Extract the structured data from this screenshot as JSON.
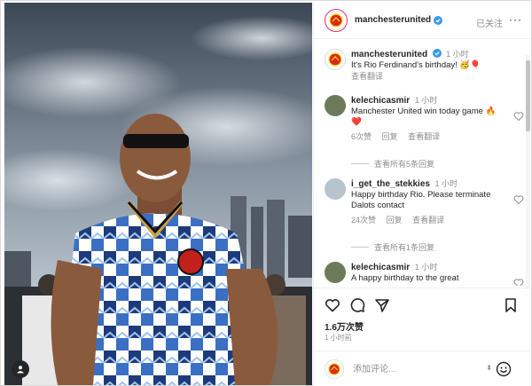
{
  "header": {
    "username": "manchesterunited",
    "follow_label": "已关注",
    "more_label": "···"
  },
  "caption": {
    "username": "manchesterunited",
    "time": "1 小时",
    "text": "It's Rio Ferdinand's birthday! 🥳🎈",
    "translate": "查看翻译"
  },
  "comments": [
    {
      "username": "kelechicasmir",
      "time": "1 小时",
      "text": "Manchester United win today game 🔥❤️",
      "likes": "6次赞",
      "reply": "回复",
      "translate": "查看翻译",
      "view_replies": "查看所有5条回复"
    },
    {
      "username": "i_get_the_stekkies",
      "time": "1 小时",
      "text": "Happy birthday Rio. Please terminate Dalots contact",
      "likes": "24次赞",
      "reply": "回复",
      "translate": "查看翻译",
      "view_replies": "查看所有1条回复"
    },
    {
      "username": "kelechicasmir",
      "time": "1 小时",
      "text": "A happy birthday to the great"
    }
  ],
  "post": {
    "likes": "1.6万次赞",
    "time": "1 小时前"
  },
  "add_comment": {
    "placeholder": "添加评论..."
  },
  "colors": {
    "accent": "#e1306c",
    "verified": "#3897f0",
    "text": "#262626",
    "muted": "#8e8e8e"
  },
  "icons": [
    "heart-icon",
    "comment-icon",
    "share-icon",
    "bookmark-icon",
    "verified-icon",
    "emoji-icon",
    "user-tag-icon"
  ]
}
